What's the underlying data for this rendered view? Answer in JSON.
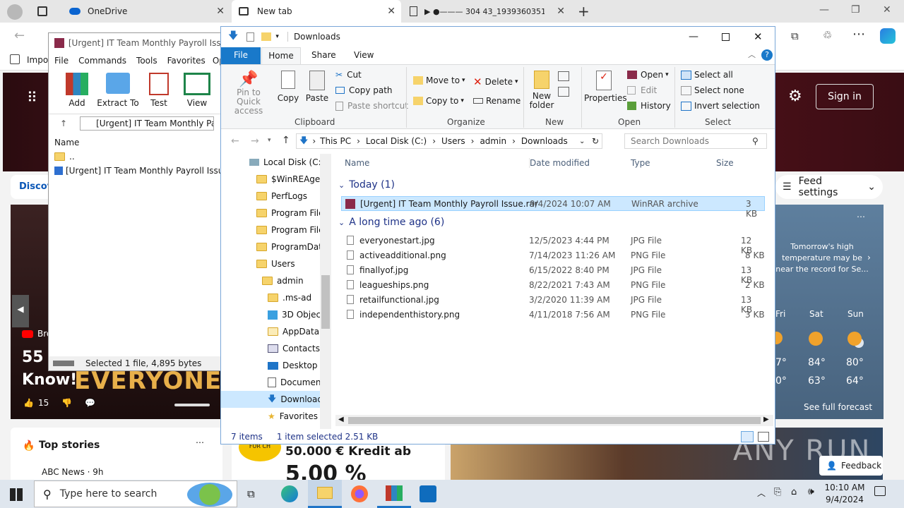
{
  "browser": {
    "tabs": [
      {
        "label": "OneDrive"
      },
      {
        "label": "New tab"
      },
      {
        "label": "▶ ●——— 304 43_1939360351.A"
      }
    ],
    "favorites_item": "Impor",
    "sign_in": "Sign in"
  },
  "page": {
    "discover": "Discov",
    "feed_settings": "Feed settings",
    "headline_line1": "55",
    "headline_line2": "Know!",
    "headline_banner": "EVERYONE S",
    "breaking": "Bre",
    "likes": "15",
    "top_stories": "Top stories",
    "abc_news": "ABC News · 9h",
    "ad_title": "50.000 € Kredit ab",
    "ad_percent": "5,00 %",
    "ad_badge": "FÜR CH",
    "feedback": "Feedback",
    "watermark": "ANY RUN",
    "weather": {
      "alert": "Tomorrow's high temperature may be near the record for Se...",
      "days": [
        {
          "name": "Fri",
          "high": "7°",
          "low": "0°"
        },
        {
          "name": "Sat",
          "high": "84°",
          "low": "63°"
        },
        {
          "name": "Sun",
          "high": "80°",
          "low": "64°"
        }
      ],
      "forecast_link": "See full forecast"
    }
  },
  "winrar": {
    "title": "[Urgent] IT Team Monthly Payroll Issue.rar",
    "menu": [
      "File",
      "Commands",
      "Tools",
      "Favorites",
      "Optio"
    ],
    "toolbar": [
      "Add",
      "Extract To",
      "Test",
      "View"
    ],
    "path": "[Urgent] IT Team Monthly Payro",
    "col_name": "Name",
    "files": [
      {
        "name": ".."
      },
      {
        "name": "[Urgent] IT Team Monthly Payroll Issue.ex"
      }
    ],
    "status": "Selected 1 file, 4,895 bytes"
  },
  "explorer": {
    "title": "Downloads",
    "ribbon_tabs": [
      "File",
      "Home",
      "Share",
      "View"
    ],
    "clipboard": {
      "pin": "Pin to Quick access",
      "copy": "Copy",
      "paste": "Paste",
      "cut": "Cut",
      "copy_path": "Copy path",
      "paste_shortcut": "Paste shortcut",
      "label": "Clipboard"
    },
    "organize": {
      "move_to": "Move to",
      "copy_to": "Copy to",
      "delete": "Delete",
      "rename": "Rename",
      "label": "Organize"
    },
    "new": {
      "new_folder": "New folder",
      "label": "New"
    },
    "open": {
      "properties": "Properties",
      "open": "Open",
      "edit": "Edit",
      "history": "History",
      "label": "Open"
    },
    "select": {
      "select_all": "Select all",
      "select_none": "Select none",
      "invert": "Invert selection",
      "label": "Select"
    },
    "breadcrumb": [
      "This PC",
      "Local Disk (C:)",
      "Users",
      "admin",
      "Downloads"
    ],
    "search_placeholder": "Search Downloads",
    "nav": [
      "Local Disk (C:)",
      "$WinREAgent",
      "PerfLogs",
      "Program Files",
      "Program Files",
      "ProgramData",
      "Users",
      "admin",
      ".ms-ad",
      "3D Objects",
      "AppData",
      "Contacts",
      "Desktop",
      "Documents",
      "Downloads",
      "Favorites"
    ],
    "columns": {
      "name": "Name",
      "date": "Date modified",
      "type": "Type",
      "size": "Size"
    },
    "groups": {
      "today": "Today (1)",
      "older": "A long time ago (6)"
    },
    "files_today": [
      {
        "name": "[Urgent] IT Team Monthly Payroll Issue.rar",
        "date": "9/4/2024 10:07 AM",
        "type": "WinRAR archive",
        "size": "3 KB"
      }
    ],
    "files_old": [
      {
        "name": "everyonestart.jpg",
        "date": "12/5/2023 4:44 PM",
        "type": "JPG File",
        "size": "12 KB"
      },
      {
        "name": "activeadditional.png",
        "date": "7/14/2023 11:26 AM",
        "type": "PNG File",
        "size": "8 KB"
      },
      {
        "name": "finallyof.jpg",
        "date": "6/15/2022 8:40 PM",
        "type": "JPG File",
        "size": "13 KB"
      },
      {
        "name": "leagueships.png",
        "date": "8/22/2021 7:43 AM",
        "type": "PNG File",
        "size": "2 KB"
      },
      {
        "name": "retailfunctional.jpg",
        "date": "3/2/2020 11:39 AM",
        "type": "JPG File",
        "size": "13 KB"
      },
      {
        "name": "independenthistory.png",
        "date": "4/11/2018 7:56 AM",
        "type": "PNG File",
        "size": "3 KB"
      }
    ],
    "status": {
      "items": "7 items",
      "selected": "1 item selected  2.51 KB"
    }
  },
  "taskbar": {
    "search_placeholder": "Type here to search",
    "time": "10:10 AM",
    "date": "9/4/2024"
  }
}
